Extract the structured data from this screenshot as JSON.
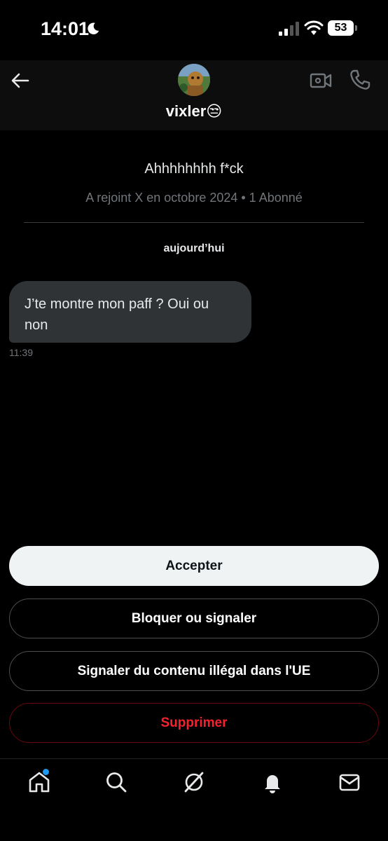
{
  "status_bar": {
    "time": "14:01",
    "battery": "53"
  },
  "header": {
    "name": "vixler😒"
  },
  "profile": {
    "bio": "Ahhhhhhhh f*ck",
    "join_info": "A rejoint X en octobre 2024 • 1 Abonné"
  },
  "conversation": {
    "day_label": "aujourd’hui",
    "messages": [
      {
        "text": "J’te montre mon paff ? Oui ou non",
        "time": "11:39"
      }
    ]
  },
  "actions": {
    "accept": "Accepter",
    "block_report": "Bloquer ou signaler",
    "report_illegal": "Signaler du contenu illégal dans l'UE",
    "delete": "Supprimer"
  },
  "bottom_nav": {
    "items": [
      "home-icon",
      "search-icon",
      "grok-icon",
      "notifications-icon",
      "messages-icon"
    ],
    "home_has_badge": true
  },
  "colors": {
    "accent": "#1d9bf0",
    "danger": "#f4212e",
    "bubble": "#2f3336",
    "muted_text": "#71767b"
  }
}
